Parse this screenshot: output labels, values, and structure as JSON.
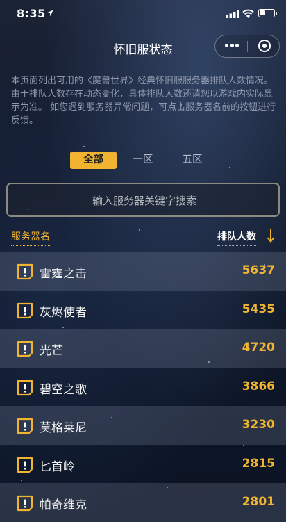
{
  "status_bar": {
    "time": "8:35"
  },
  "navbar": {
    "title": "怀旧服状态"
  },
  "description": "本页面列出可用的《魔兽世界》经典怀旧服服务器排队人数情况。由于排队人数存在动态变化，具体排队人数还请您以游戏内实际显示为准。 如您遇到服务器异常问题，可点击服务器名前的按钮进行反馈。",
  "tabs": [
    {
      "label": "全部",
      "active": true
    },
    {
      "label": "一区",
      "active": false
    },
    {
      "label": "五区",
      "active": false
    }
  ],
  "search": {
    "placeholder": "输入服务器关键字搜索",
    "value": ""
  },
  "table": {
    "col_name": "服务器名",
    "col_queue": "排队人数",
    "sort": "descending",
    "rows": [
      {
        "name": "雷霆之击",
        "count": "5637"
      },
      {
        "name": "灰烬使者",
        "count": "5435"
      },
      {
        "name": "光芒",
        "count": "4720"
      },
      {
        "name": "碧空之歌",
        "count": "3866"
      },
      {
        "name": "莫格莱尼",
        "count": "3230"
      },
      {
        "name": "匕首岭",
        "count": "2815"
      },
      {
        "name": "帕奇维克",
        "count": "2801"
      }
    ]
  },
  "colors": {
    "accent": "#f0b430",
    "background": "#101829"
  },
  "icons": [
    "location-arrow-icon",
    "signal-icon",
    "wifi-icon",
    "battery-icon",
    "more-dots-icon",
    "close-target-icon",
    "sort-down-arrow-icon",
    "feedback-alert-icon"
  ]
}
